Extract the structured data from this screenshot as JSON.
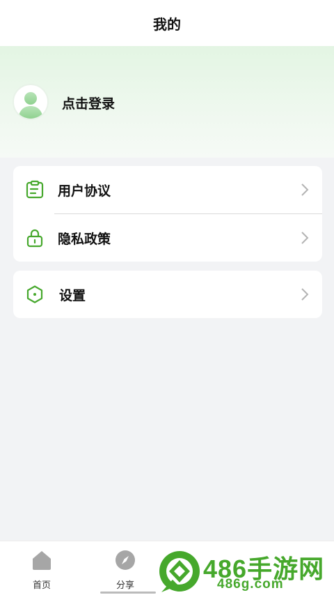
{
  "header": {
    "title": "我的"
  },
  "profile": {
    "login_text": "点击登录"
  },
  "menu_group_1": {
    "items": [
      {
        "label": "用户协议",
        "icon": "clipboard-icon"
      },
      {
        "label": "隐私政策",
        "icon": "lock-icon"
      }
    ]
  },
  "menu_group_2": {
    "items": [
      {
        "label": "设置",
        "icon": "settings-hexagon-icon"
      }
    ]
  },
  "tabbar": {
    "tabs": [
      {
        "label": "首页",
        "icon": "home-icon"
      },
      {
        "label": "分享",
        "icon": "compass-icon"
      }
    ]
  },
  "watermark": {
    "text": "486手游网",
    "url": "486g.com"
  },
  "colors": {
    "accent": "#46a82c",
    "background": "#f2f3f5",
    "profile_bg": "#e3f5e3"
  }
}
